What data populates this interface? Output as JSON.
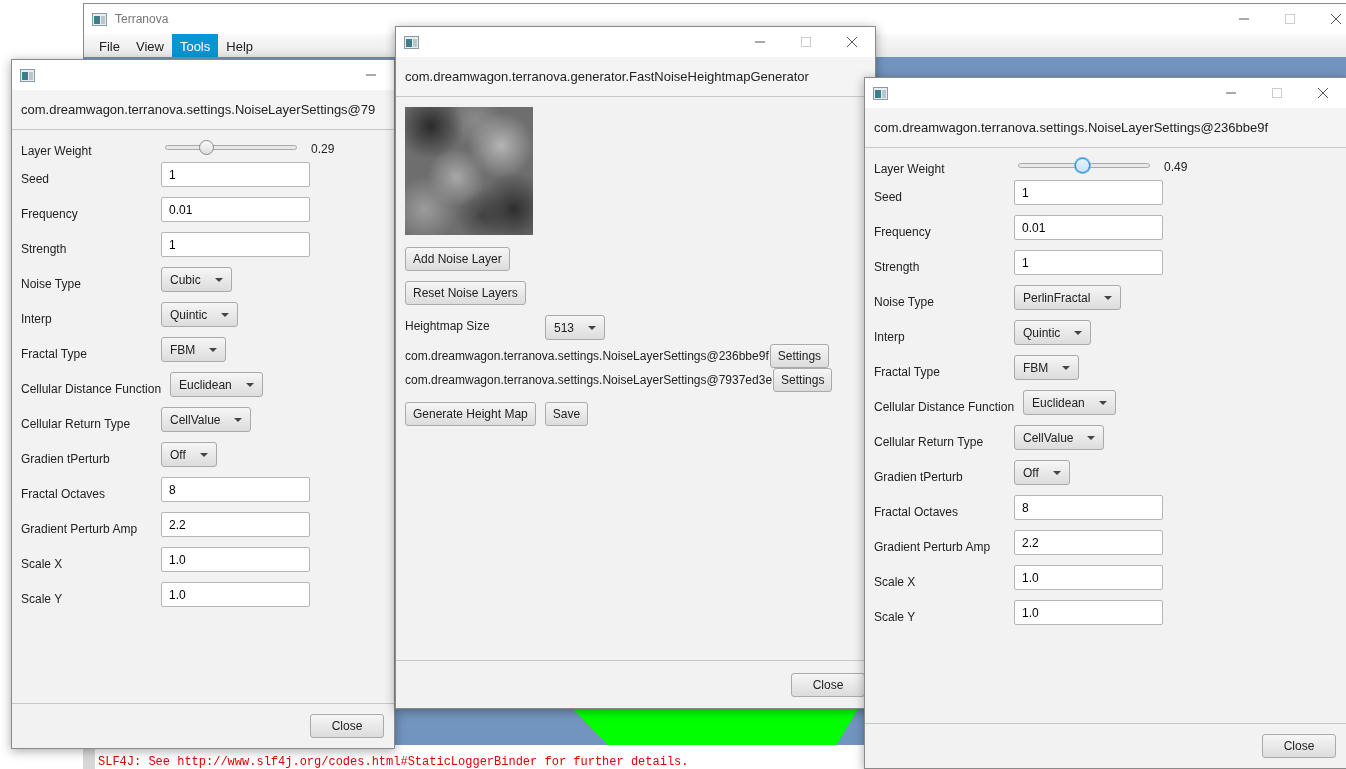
{
  "main_window": {
    "title": "Terranova",
    "menu": [
      {
        "label": "File",
        "selected": false
      },
      {
        "label": "View",
        "selected": false
      },
      {
        "label": "Tools",
        "selected": true
      },
      {
        "label": "Help",
        "selected": false
      }
    ]
  },
  "console": {
    "lines": [
      "SLF4J: See http://www.slf4j.org/codes.html#StaticLoggerBinder for further details."
    ]
  },
  "settings_windows": [
    {
      "header": "com.dreamwagon.terranova.settings.NoiseLayerSettings@79",
      "fields": [
        {
          "kind": "slider",
          "label": "Layer Weight",
          "level": 0.29,
          "reading": "0.29",
          "focused": false
        },
        {
          "kind": "text",
          "label": "Seed",
          "value": "1"
        },
        {
          "kind": "text",
          "label": "Frequency",
          "value": "0.01"
        },
        {
          "kind": "text",
          "label": "Strength",
          "value": "1"
        },
        {
          "kind": "select",
          "label": "Noise Type",
          "value": "Cubic"
        },
        {
          "kind": "select",
          "label": "Interp",
          "value": "Quintic"
        },
        {
          "kind": "select",
          "label": "Fractal Type",
          "value": "FBM"
        },
        {
          "kind": "select",
          "label": "Cellular Distance Function",
          "value": "Euclidean"
        },
        {
          "kind": "select",
          "label": "Cellular Return Type",
          "value": "CellValue"
        },
        {
          "kind": "select",
          "label": "Gradien tPerturb",
          "value": "Off"
        },
        {
          "kind": "text",
          "label": "Fractal Octaves",
          "value": "8"
        },
        {
          "kind": "text",
          "label": "Gradient Perturb Amp",
          "value": "2.2"
        },
        {
          "kind": "text",
          "label": "Scale X",
          "value": "1.0"
        },
        {
          "kind": "text",
          "label": "Scale Y",
          "value": "1.0"
        }
      ],
      "close_button": "Close"
    },
    {
      "header": "com.dreamwagon.terranova.settings.NoiseLayerSettings@236bbe9f",
      "fields": [
        {
          "kind": "slider",
          "label": "Layer Weight",
          "level": 0.49,
          "reading": "0.49",
          "focused": true
        },
        {
          "kind": "text",
          "label": "Seed",
          "value": "1"
        },
        {
          "kind": "text",
          "label": "Frequency",
          "value": "0.01"
        },
        {
          "kind": "text",
          "label": "Strength",
          "value": "1"
        },
        {
          "kind": "select",
          "label": "Noise Type",
          "value": "PerlinFractal"
        },
        {
          "kind": "select",
          "label": "Interp",
          "value": "Quintic"
        },
        {
          "kind": "select",
          "label": "Fractal Type",
          "value": "FBM"
        },
        {
          "kind": "select",
          "label": "Cellular Distance Function",
          "value": "Euclidean"
        },
        {
          "kind": "select",
          "label": "Cellular Return Type",
          "value": "CellValue"
        },
        {
          "kind": "select",
          "label": "Gradien tPerturb",
          "value": "Off"
        },
        {
          "kind": "text",
          "label": "Fractal Octaves",
          "value": "8"
        },
        {
          "kind": "text",
          "label": "Gradient Perturb Amp",
          "value": "2.2"
        },
        {
          "kind": "text",
          "label": "Scale X",
          "value": "1.0"
        },
        {
          "kind": "text",
          "label": "Scale Y",
          "value": "1.0"
        }
      ],
      "close_button": "Close"
    }
  ],
  "generator_window": {
    "header": "com.dreamwagon.terranova.generator.FastNoiseHeightmapGenerator",
    "add_button": "Add Noise Layer",
    "reset_button": "Reset Noise Layers",
    "size_label": "Heightmap Size",
    "size_value": "513",
    "layers": [
      {
        "name": "com.dreamwagon.terranova.settings.NoiseLayerSettings@236bbe9f",
        "button": "Settings"
      },
      {
        "name": "com.dreamwagon.terranova.settings.NoiseLayerSettings@7937ed3e",
        "button": "Settings"
      }
    ],
    "generate_button": "Generate Height Map",
    "save_button": "Save",
    "close_button": "Close"
  }
}
